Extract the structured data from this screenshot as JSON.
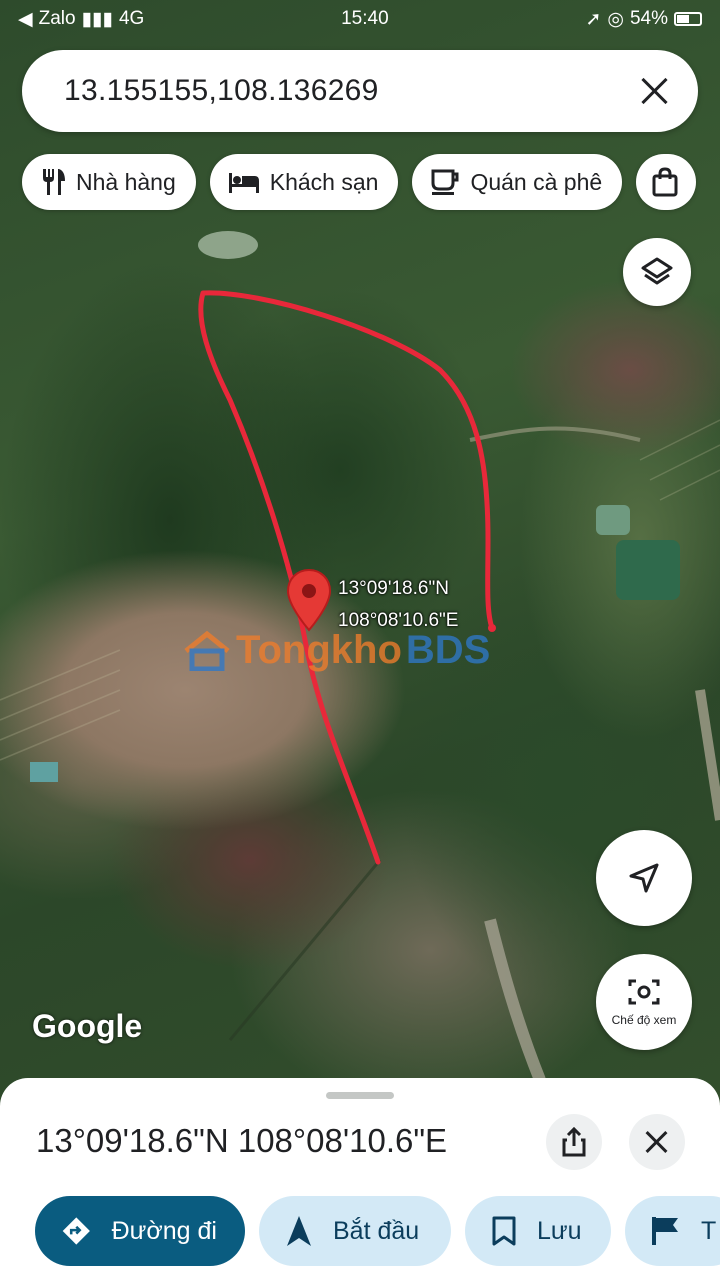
{
  "status_bar": {
    "carrier": "Zalo",
    "network": "4G",
    "time": "15:40",
    "battery": "54%"
  },
  "search": {
    "query": "13.155155,108.136269"
  },
  "chips": [
    {
      "label": "Nhà hàng",
      "icon": "restaurant-icon"
    },
    {
      "label": "Khách sạn",
      "icon": "hotel-icon"
    },
    {
      "label": "Quán cà phê",
      "icon": "coffee-icon"
    },
    {
      "label": "",
      "icon": "shopping-bag-icon"
    }
  ],
  "map": {
    "pin_lat": "13°09'18.6\"N",
    "pin_lng": "108°08'10.6\"E",
    "watermark_part1": "Tongkho",
    "watermark_part2": "BDS",
    "attribution": "Google",
    "boundary_color": "#e8283a",
    "view_mode_label": "Chế độ xem"
  },
  "sheet": {
    "title": "13°09'18.6\"N 108°08'10.6\"E",
    "actions": [
      {
        "label": "Đường đi",
        "icon": "directions-icon"
      },
      {
        "label": "Bắt đầu",
        "icon": "navigation-arrow-icon"
      },
      {
        "label": "Lưu",
        "icon": "bookmark-icon"
      },
      {
        "label": "T",
        "icon": "flag-icon"
      }
    ]
  },
  "colors": {
    "primary_action": "#0a5c80",
    "secondary_action": "#d3e9f6",
    "pin": "#e53935"
  }
}
